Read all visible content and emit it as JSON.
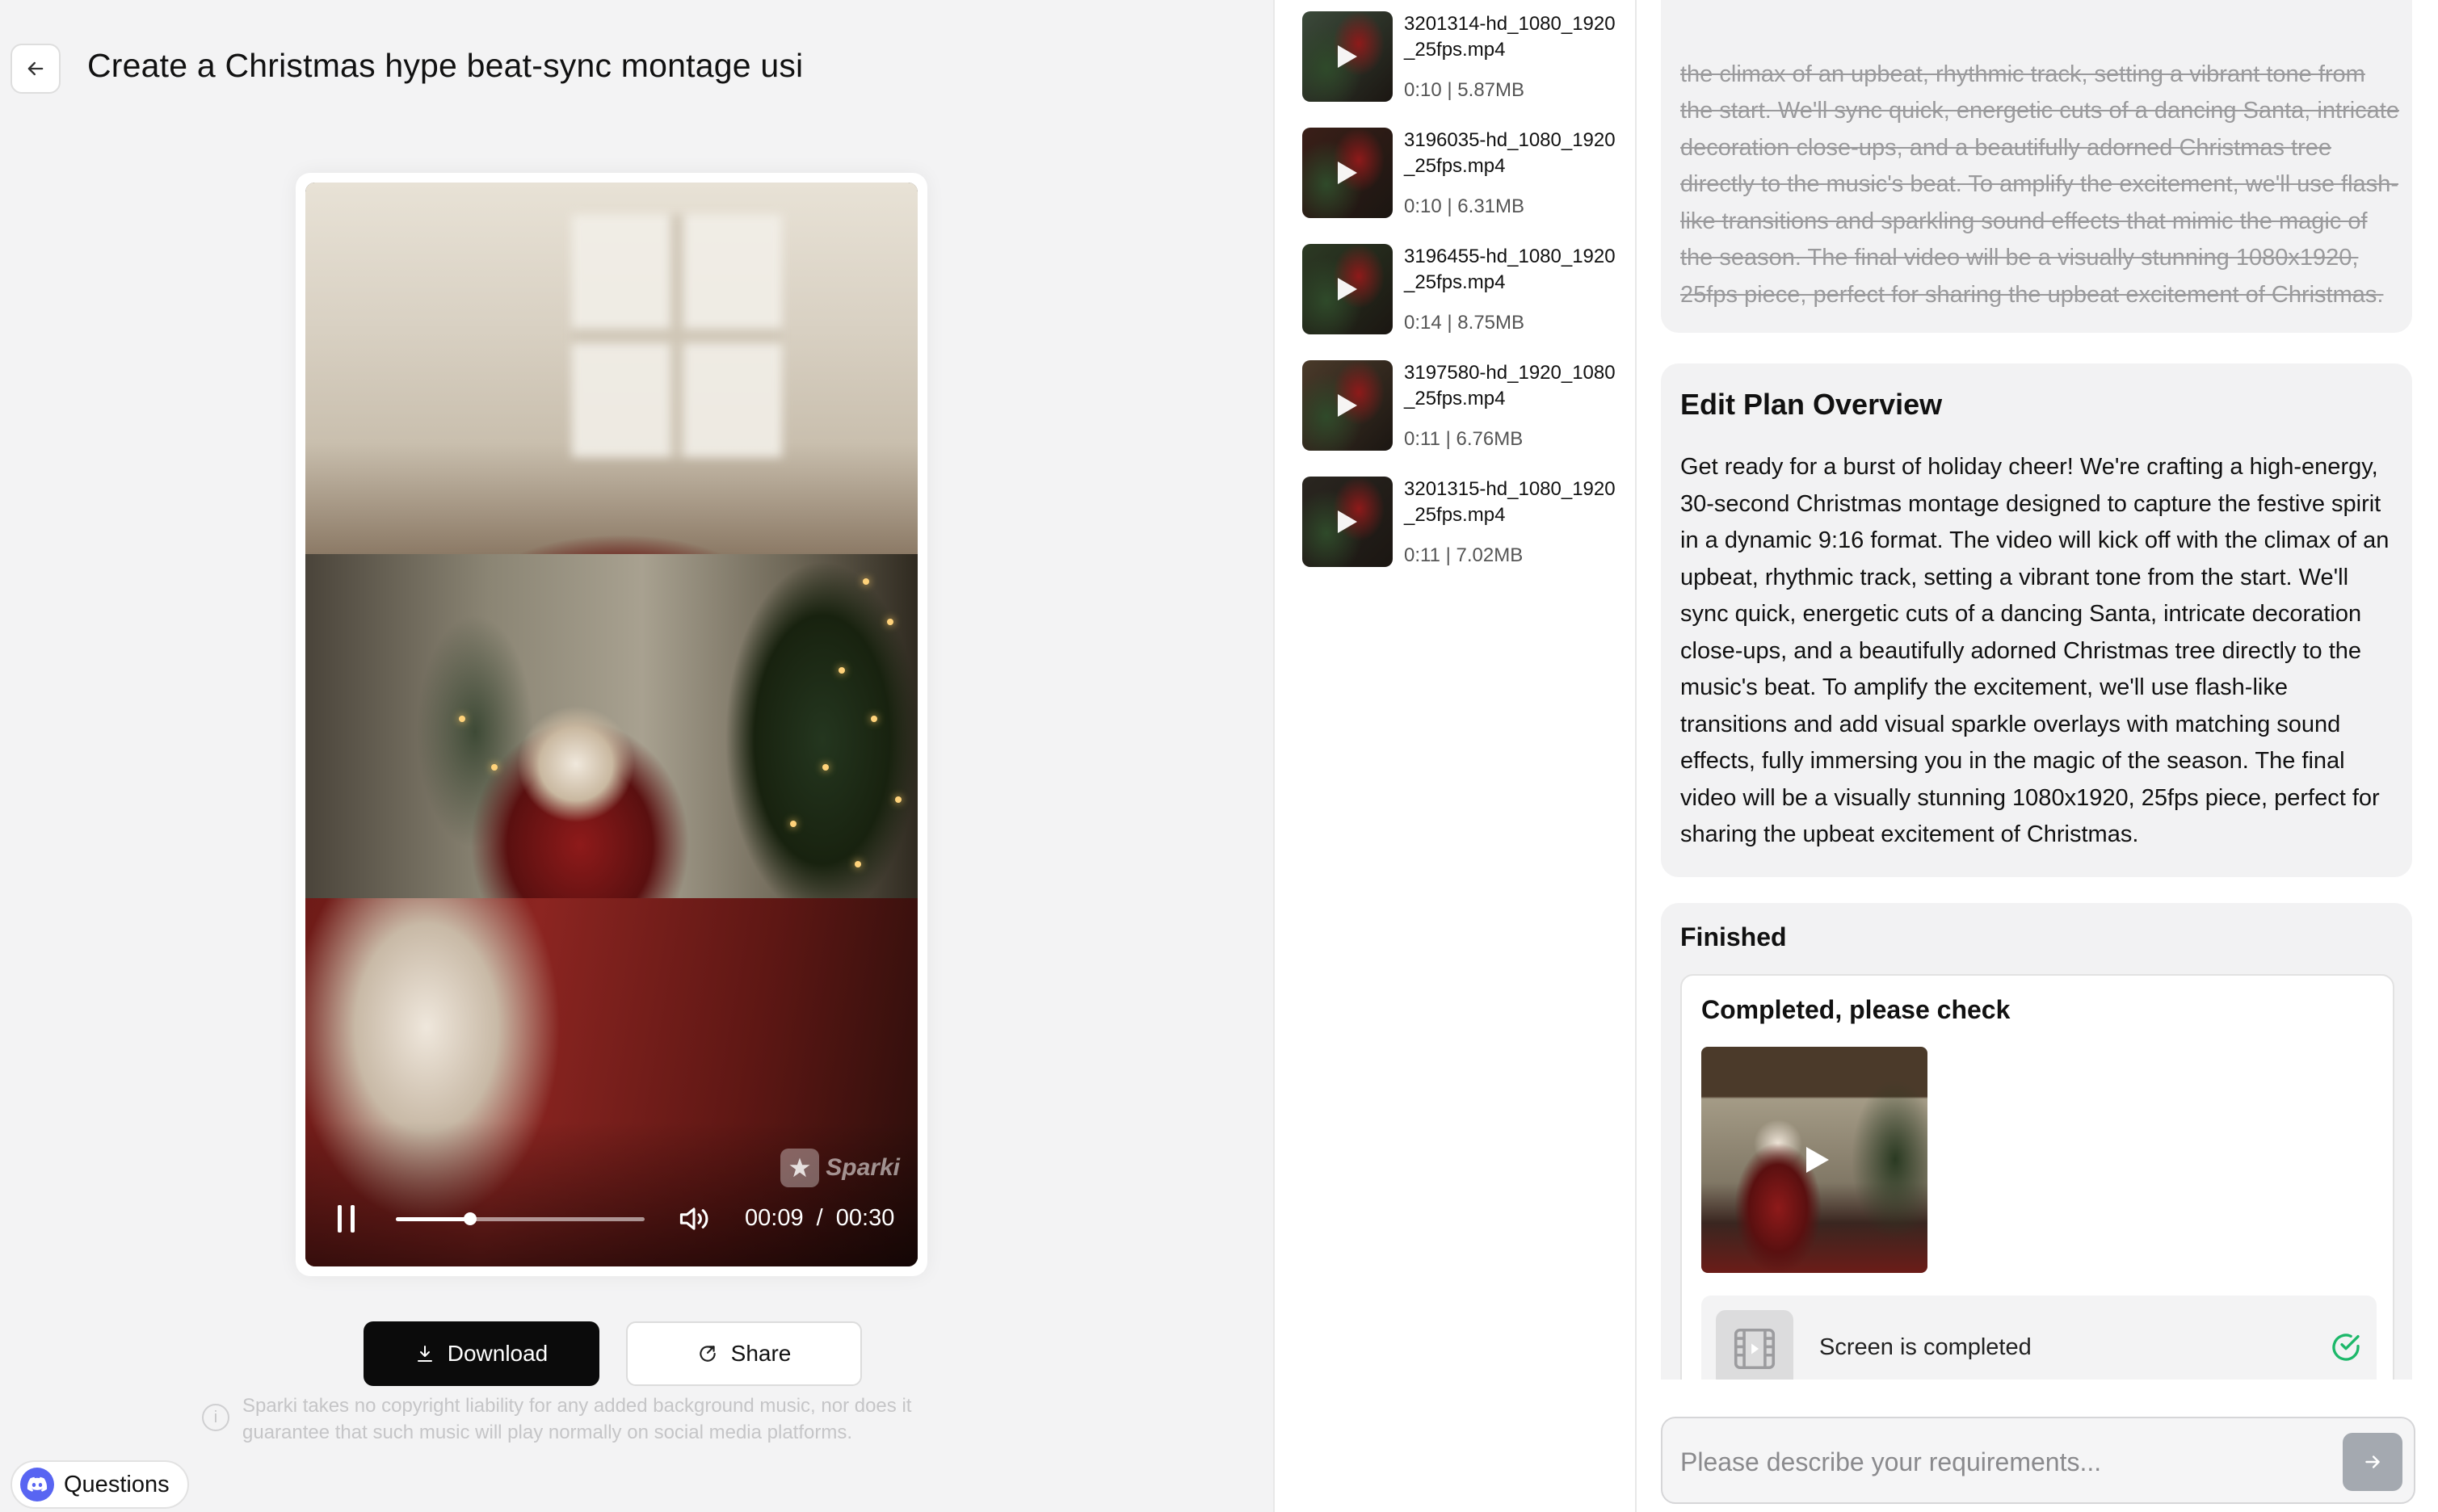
{
  "header": {
    "title": "Create a Christmas hype beat-sync montage usi"
  },
  "player": {
    "watermark": "Sparki",
    "current_time": "00:09",
    "time_separator": "/",
    "duration": "00:30",
    "progress": 0.3
  },
  "actions": {
    "download_label": "Download",
    "share_label": "Share",
    "disclaimer": "Sparki takes no copyright liability for any added background music, nor does it guarantee that such music will play normally on social media platforms.",
    "questions_label": "Questions"
  },
  "files": [
    {
      "name": "3201314-hd_1080_1920_25fps.mp4",
      "duration": "0:10",
      "size": "5.87MB",
      "thumb_color": "#3b4a3a"
    },
    {
      "name": "3196035-hd_1080_1920_25fps.mp4",
      "duration": "0:10",
      "size": "6.31MB",
      "thumb_color": "#3a1f18"
    },
    {
      "name": "3196455-hd_1080_1920_25fps.mp4",
      "duration": "0:14",
      "size": "8.75MB",
      "thumb_color": "#2c3a24"
    },
    {
      "name": "3197580-hd_1920_1080_25fps.mp4",
      "duration": "0:11",
      "size": "6.76MB",
      "thumb_color": "#4a3a2a"
    },
    {
      "name": "3201315-hd_1080_1920_25fps.mp4",
      "duration": "0:11",
      "size": "7.02MB",
      "thumb_color": "#2a2620"
    }
  ],
  "chat": {
    "previous_text": "the climax of an upbeat, rhythmic track, setting a vibrant tone from the start. We'll sync quick, energetic cuts of a dancing Santa, intricate decoration close-ups, and a beautifully adorned Christmas tree directly to the music's beat. To amplify the excitement, we'll use flash-like transitions and sparkling sound effects that mimic the magic of the season. The final video will be a visually stunning 1080x1920, 25fps piece, perfect for sharing the upbeat excitement of Christmas.",
    "plan_title": "Edit Plan Overview",
    "plan_body": "Get ready for a burst of holiday cheer! We're crafting a high-energy, 30-second Christmas montage designed to capture the festive spirit in a dynamic 9:16 format. The video will kick off with the climax of an upbeat, rhythmic track, setting a vibrant tone from the start. We'll sync quick, energetic cuts of a dancing Santa, intricate decoration close-ups, and a beautifully adorned Christmas tree directly to the music's beat. To amplify the excitement, we'll use flash-like transitions and add visual sparkle overlays with matching sound effects, fully immersing you in the magic of the season. The final video will be a visually stunning 1080x1920, 25fps piece, perfect for sharing the upbeat excitement of Christmas.",
    "finished_title": "Finished",
    "completed_title": "Completed, please check",
    "status_text": "Screen is completed"
  },
  "prompt": {
    "placeholder": "Please describe your requirements..."
  },
  "colors": {
    "accent_dark": "#0b0b0b",
    "success": "#1db86a",
    "discord": "#5865f2",
    "send_disabled": "#a4a9b0"
  }
}
